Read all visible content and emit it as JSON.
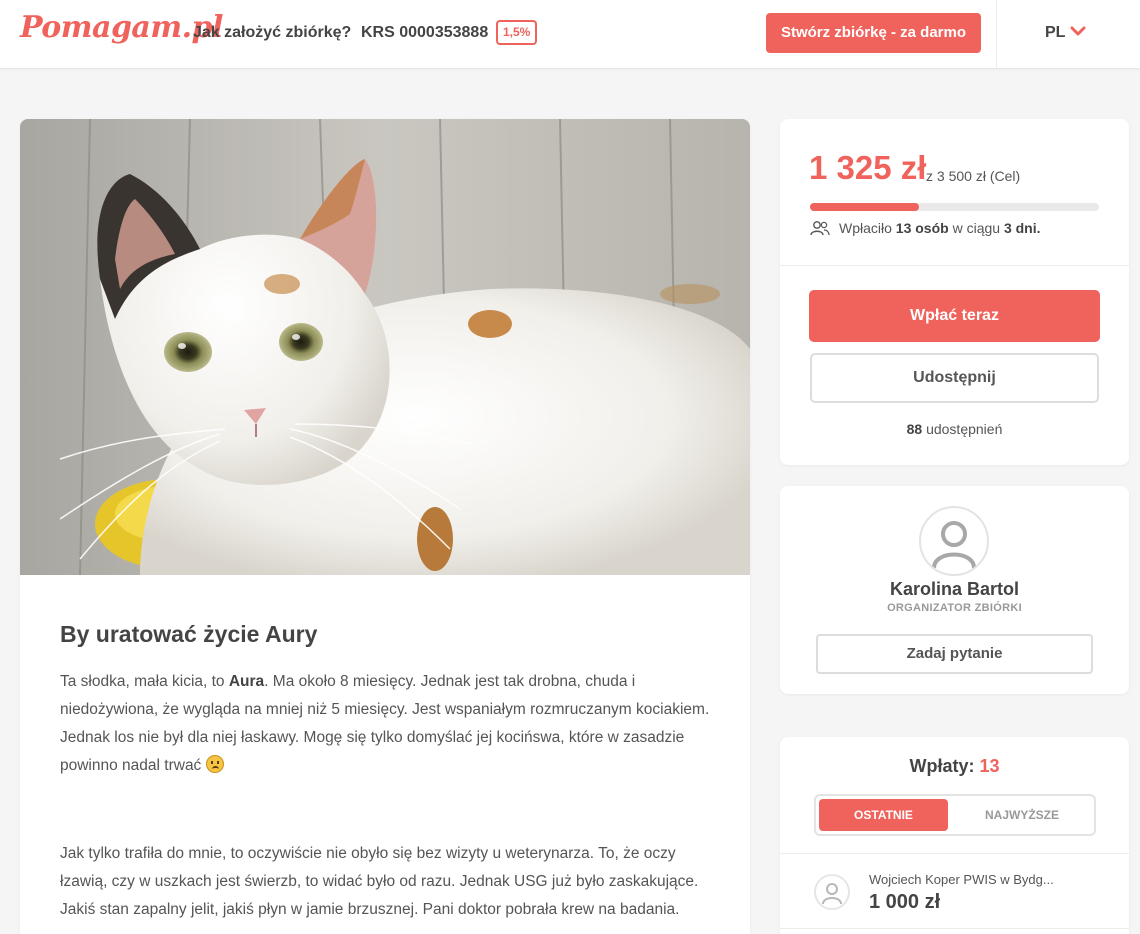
{
  "header": {
    "logo": "Pomagam.pl",
    "how_to": "Jak założyć zbiórkę?",
    "krs": "KRS 0000353888",
    "krs_badge": "1,5%",
    "create_button": "Stwórz zbiórkę - za darmo",
    "language": "PL"
  },
  "campaign": {
    "title": "By uratować życie Aury",
    "paragraphs": [
      {
        "before": "Ta słodka, mała kicia, to ",
        "bold": "Aura",
        "after": ". Ma około 8 miesięcy. Jednak jest tak drobna, chuda i niedożywiona, że wygląda na mniej niż 5 miesięcy. Jest wspaniałym rozmruczanym kociakiem. Jednak los nie był dla niej łaskawy. Mogę się tylko domyślać jej kocińswa, które w zasadzie powinno nadal trwać"
      },
      {
        "text": "Jak tylko trafiła do mnie, to oczywiście nie obyło się bez wizyty u weterynarza. To, że oczy łzawią, czy w uszkach jest świerzb, to widać było od razu. Jednak USG już było zaskakujące. Jakiś stan zapalny jelit, jakiś płyn w jamie brzusznej. Pani doktor pobrała krew na badania."
      }
    ]
  },
  "funding": {
    "raised": "1 325 zł",
    "goal_text": "z 3 500 zł (Cel)",
    "progress": 0.3786,
    "donors_prefix": "Wpłaciło",
    "donors_count": "13 osób",
    "donors_mid": "w ciągu",
    "days": "3 dni.",
    "pay_button": "Wpłać teraz",
    "share_button": "Udostępnij",
    "share_count": "88",
    "share_label": "udostępnień"
  },
  "organizer": {
    "name": "Karolina Bartol",
    "role": "ORGANIZATOR ZBIÓRKI",
    "ask_button": "Zadaj pytanie"
  },
  "payments": {
    "title": "Wpłaty:",
    "count": "13",
    "tabs": [
      "OSTATNIE",
      "NAJWYŻSZE"
    ],
    "items": [
      {
        "name": "Wojciech Koper PWIS w Bydg...",
        "amount": "1 000 zł"
      }
    ]
  },
  "colors": {
    "accent": "#f0625c",
    "text": "#444444",
    "background": "#f5f5f5"
  }
}
